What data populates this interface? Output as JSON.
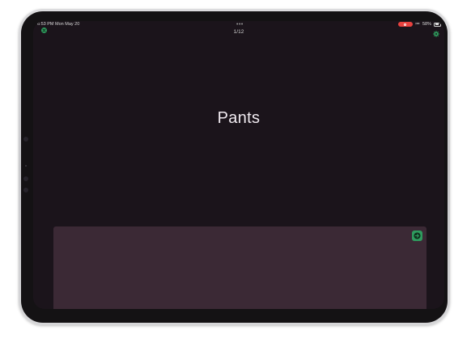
{
  "status_bar": {
    "time_date": "6:53 PM  Mon May 20",
    "battery_text": "58%",
    "multitask_dots": "•••"
  },
  "card": {
    "counter": "1/12",
    "word": "Pants"
  },
  "colors": {
    "screen_bg": "#1b141b",
    "panel_bg": "#3b2935",
    "accent_green": "#2e9b5e",
    "recording_red": "#e8423f"
  },
  "icons": {
    "top_left": "close-icon",
    "top_right": "gear-icon",
    "next": "arrow-right-icon"
  }
}
